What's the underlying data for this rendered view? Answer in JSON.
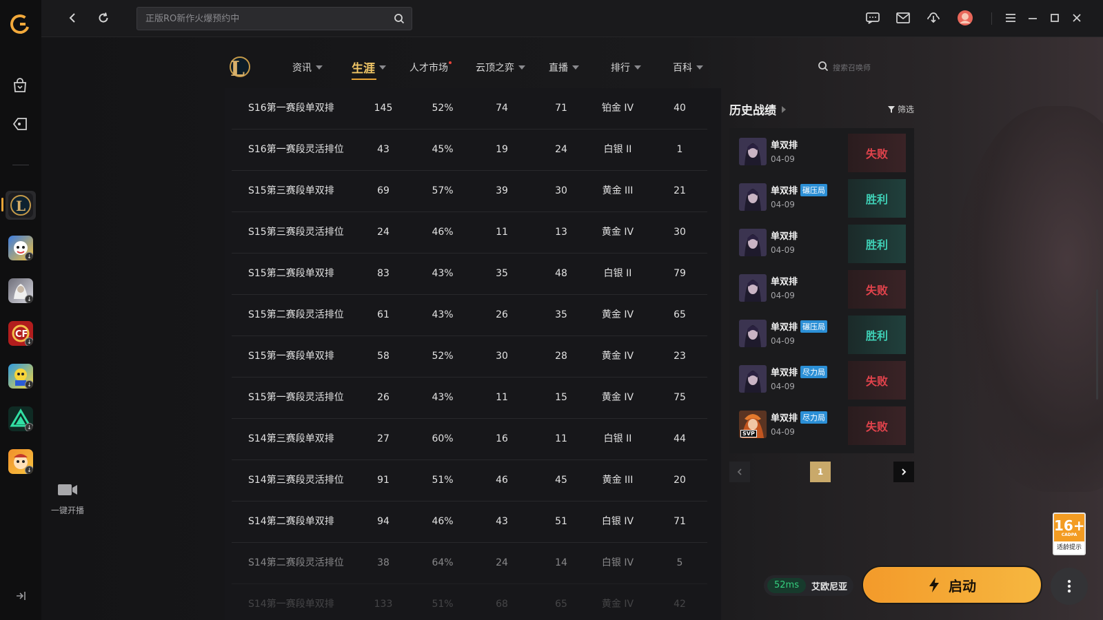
{
  "topbar": {
    "search_placeholder": "正版RO新作火爆预约中"
  },
  "nav": {
    "items": [
      {
        "label": "资讯"
      },
      {
        "label": "生涯"
      },
      {
        "label": "人才市场"
      },
      {
        "label": "云顶之弈"
      },
      {
        "label": "直播"
      },
      {
        "label": "排行"
      },
      {
        "label": "百科"
      }
    ],
    "search_placeholder": "搜索召唤师"
  },
  "career": {
    "rows": [
      {
        "season": "S16第一赛段单双排",
        "games": "145",
        "winrate": "52%",
        "wins": "74",
        "losses": "71",
        "rank": "铂金 IV",
        "lp": "40"
      },
      {
        "season": "S16第一赛段灵活排位",
        "games": "43",
        "winrate": "45%",
        "wins": "19",
        "losses": "24",
        "rank": "白银 II",
        "lp": "1"
      },
      {
        "season": "S15第三赛段单双排",
        "games": "69",
        "winrate": "57%",
        "wins": "39",
        "losses": "30",
        "rank": "黄金 III",
        "lp": "21"
      },
      {
        "season": "S15第三赛段灵活排位",
        "games": "24",
        "winrate": "46%",
        "wins": "11",
        "losses": "13",
        "rank": "黄金 IV",
        "lp": "30"
      },
      {
        "season": "S15第二赛段单双排",
        "games": "83",
        "winrate": "43%",
        "wins": "35",
        "losses": "48",
        "rank": "白银 II",
        "lp": "79"
      },
      {
        "season": "S15第二赛段灵活排位",
        "games": "61",
        "winrate": "43%",
        "wins": "26",
        "losses": "35",
        "rank": "黄金 IV",
        "lp": "65"
      },
      {
        "season": "S15第一赛段单双排",
        "games": "58",
        "winrate": "52%",
        "wins": "30",
        "losses": "28",
        "rank": "黄金 IV",
        "lp": "23"
      },
      {
        "season": "S15第一赛段灵活排位",
        "games": "26",
        "winrate": "43%",
        "wins": "11",
        "losses": "15",
        "rank": "黄金 IV",
        "lp": "75"
      },
      {
        "season": "S14第三赛段单双排",
        "games": "27",
        "winrate": "60%",
        "wins": "16",
        "losses": "11",
        "rank": "白银 II",
        "lp": "44"
      },
      {
        "season": "S14第三赛段灵活排位",
        "games": "91",
        "winrate": "51%",
        "wins": "46",
        "losses": "45",
        "rank": "黄金 III",
        "lp": "20"
      },
      {
        "season": "S14第二赛段单双排",
        "games": "94",
        "winrate": "46%",
        "wins": "43",
        "losses": "51",
        "rank": "白银 IV",
        "lp": "71"
      },
      {
        "season": "S14第二赛段灵活排位",
        "games": "38",
        "winrate": "64%",
        "wins": "24",
        "losses": "14",
        "rank": "白银 IV",
        "lp": "5"
      },
      {
        "season": "S14第一赛段单双排",
        "games": "133",
        "winrate": "51%",
        "wins": "68",
        "losses": "65",
        "rank": "黄金 IV",
        "lp": "42"
      }
    ]
  },
  "history": {
    "title": "历史战绩",
    "filter_label": "筛选",
    "matches": [
      {
        "mode": "单双排",
        "tag": "",
        "date": "04-09",
        "result": "失败",
        "outcome": "loss"
      },
      {
        "mode": "单双排",
        "tag": "碾压局",
        "date": "04-09",
        "result": "胜利",
        "outcome": "win"
      },
      {
        "mode": "单双排",
        "tag": "",
        "date": "04-09",
        "result": "胜利",
        "outcome": "win"
      },
      {
        "mode": "单双排",
        "tag": "",
        "date": "04-09",
        "result": "失败",
        "outcome": "loss"
      },
      {
        "mode": "单双排",
        "tag": "碾压局",
        "date": "04-09",
        "result": "胜利",
        "outcome": "win"
      },
      {
        "mode": "单双排",
        "tag": "尽力局",
        "date": "04-09",
        "result": "失败",
        "outcome": "loss"
      },
      {
        "mode": "单双排",
        "tag": "尽力局",
        "date": "04-09",
        "result": "失败",
        "outcome": "loss",
        "badge": "SVP"
      }
    ],
    "current_page": "1"
  },
  "sidebar": {
    "live_label": "一键开播"
  },
  "launch": {
    "ping": "52ms",
    "server": "艾欧尼亚",
    "button_label": "启动"
  },
  "age_rating": {
    "age": "16+",
    "org": "CADPA",
    "label": "适龄提示"
  },
  "colors": {
    "accent": "#e8a437",
    "win": "#3fd0b6",
    "loss": "#e2434c",
    "launch": "#f4a734"
  }
}
